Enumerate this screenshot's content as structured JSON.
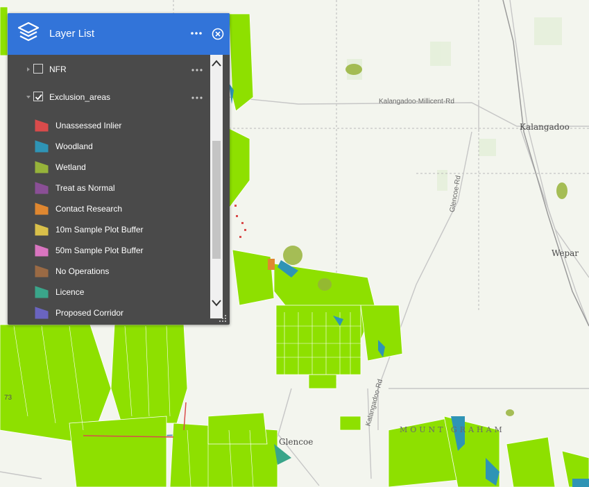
{
  "panel": {
    "title": "Layer List",
    "menu_icon": "more-horizontal-icon",
    "close_icon": "close-circle-icon",
    "header_icon": "layers-icon"
  },
  "layers": [
    {
      "label": "NFR",
      "checked": false,
      "expanded": false
    },
    {
      "label": "Exclusion_areas",
      "checked": true,
      "expanded": true
    }
  ],
  "legend": [
    {
      "label": "Unassessed Inlier",
      "color": "#d94b4b"
    },
    {
      "label": "Woodland",
      "color": "#2f94b5"
    },
    {
      "label": "Wetland",
      "color": "#96b33a"
    },
    {
      "label": "Treat as Normal",
      "color": "#8a4f95"
    },
    {
      "label": "Contact Research",
      "color": "#df8730"
    },
    {
      "label": "10m Sample Plot Buffer",
      "color": "#d9c04a"
    },
    {
      "label": "50m Sample Plot Buffer",
      "color": "#d975c0"
    },
    {
      "label": "No Operations",
      "color": "#9a6a44"
    },
    {
      "label": "Licence",
      "color": "#3aa58a"
    },
    {
      "label": "Proposed Corridor",
      "color": "#6a64c0"
    }
  ],
  "map": {
    "places": {
      "kalangadoo": "Kalangadoo",
      "wepar": "Wepar",
      "glencoe": "Glencoe",
      "mount_graham": "MOUNT GRAHAM"
    },
    "roads": {
      "kalangadoo_millicent": "Kalangadoo-Millicent-Rd",
      "glencoe_rd": "Glencoe-Rd",
      "kalangadoo_rd": "Kalangadoo-Rd",
      "route": "73"
    },
    "colors": {
      "plantation": "#8ee000",
      "background": "#f3f5ee",
      "woodland": "#2f94b5",
      "panel_header": "#3274d9",
      "panel_body": "#4a4a4a"
    }
  }
}
